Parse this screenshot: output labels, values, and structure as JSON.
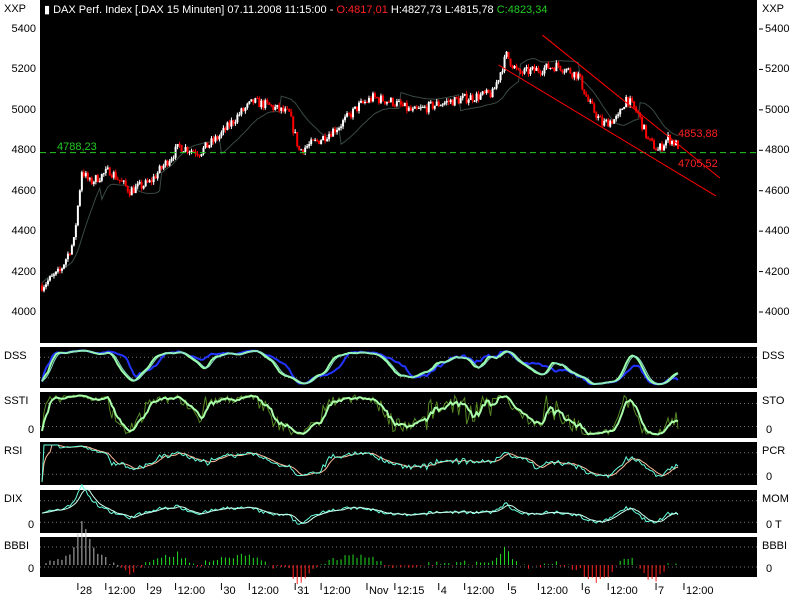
{
  "header": {
    "left_unit": "XXP",
    "right_unit": "XXP",
    "title": "DAX Perf. Index [.DAX  15 Minuten] 07.11.2008 11:15:00 - ",
    "open": "O:4817,01",
    "high_low": "H:4827,73 L:4815,78",
    "close": "C:4823,34"
  },
  "colors": {
    "up": "#ffffff",
    "down": "#ff0000",
    "ref_line": "#22cc22",
    "channel": "#ff0000",
    "band": "#3a4a44"
  },
  "chart_data": {
    "type": "candlestick",
    "title": "DAX Perf. Index [.DAX  15 Minuten]",
    "ylim": [
      3900,
      5500
    ],
    "yticks": [
      {
        "v": 4000,
        "label": "4000"
      },
      {
        "v": 4200,
        "label": "4200"
      },
      {
        "v": 4400,
        "label": "4400"
      },
      {
        "v": 4600,
        "label": "4600"
      },
      {
        "v": 4800,
        "label": "4800"
      },
      {
        "v": 5000,
        "label": "5000"
      },
      {
        "v": 5200,
        "label": "5200"
      },
      {
        "v": 5400,
        "label": "5400"
      }
    ],
    "bars": 320,
    "price_anchors": [
      [
        0,
        4130
      ],
      [
        9,
        4200
      ],
      [
        16,
        4350
      ],
      [
        20,
        4700
      ],
      [
        24,
        4640
      ],
      [
        34,
        4700
      ],
      [
        44,
        4600
      ],
      [
        54,
        4640
      ],
      [
        59,
        4700
      ],
      [
        69,
        4820
      ],
      [
        79,
        4790
      ],
      [
        89,
        4870
      ],
      [
        99,
        4980
      ],
      [
        106,
        5040
      ],
      [
        114,
        5020
      ],
      [
        124,
        4980
      ],
      [
        129,
        4800
      ],
      [
        139,
        4850
      ],
      [
        149,
        4920
      ],
      [
        159,
        5020
      ],
      [
        166,
        5060
      ],
      [
        176,
        5040
      ],
      [
        186,
        4990
      ],
      [
        199,
        5030
      ],
      [
        214,
        5060
      ],
      [
        226,
        5080
      ],
      [
        233,
        5270
      ],
      [
        239,
        5180
      ],
      [
        249,
        5200
      ],
      [
        259,
        5220
      ],
      [
        269,
        5170
      ],
      [
        274,
        5040
      ],
      [
        281,
        4930
      ],
      [
        289,
        4960
      ],
      [
        293,
        5060
      ],
      [
        299,
        4980
      ],
      [
        304,
        4850
      ],
      [
        309,
        4800
      ],
      [
        314,
        4860
      ],
      [
        319,
        4823
      ]
    ],
    "reference_line": {
      "value": 4788.23,
      "label": "4788,23"
    },
    "channel": {
      "upper": [
        [
          251,
          5370
        ],
        [
          340,
          4663
        ]
      ],
      "lower": [
        [
          229,
          5222
        ],
        [
          338,
          4574
        ]
      ],
      "labels": [
        {
          "v": 4853.88,
          "label": "4853,88"
        },
        {
          "v": 4705.52,
          "label": "4705,52"
        }
      ]
    },
    "xticks": [
      {
        "bar": 20,
        "label": "28"
      },
      {
        "bar": 34,
        "label": "12:00"
      },
      {
        "bar": 55,
        "label": "29"
      },
      {
        "bar": 69,
        "label": "12:00"
      },
      {
        "bar": 92,
        "label": "30"
      },
      {
        "bar": 106,
        "label": "12:00"
      },
      {
        "bar": 129,
        "label": "31"
      },
      {
        "bar": 142,
        "label": "12:00"
      },
      {
        "bar": 165,
        "label": "Nov"
      },
      {
        "bar": 179,
        "label": "12:15"
      },
      {
        "bar": 201,
        "label": "4"
      },
      {
        "bar": 214,
        "label": "12:00"
      },
      {
        "bar": 236,
        "label": "5"
      },
      {
        "bar": 251,
        "label": "12:00"
      },
      {
        "bar": 273,
        "label": "6"
      },
      {
        "bar": 286,
        "label": "12:00"
      },
      {
        "bar": 310,
        "label": "7"
      },
      {
        "bar": 324,
        "label": "12:00"
      }
    ],
    "panels": [
      {
        "id": "dss",
        "left": "DSS",
        "right": "DSS",
        "zero_left": "",
        "zero_right": ""
      },
      {
        "id": "ssti",
        "left": "SSTI",
        "right": "STO",
        "zero_left": "0",
        "zero_right": "0"
      },
      {
        "id": "rsi",
        "left": "RSI",
        "right": "PCR",
        "zero_left": "",
        "zero_right": "0"
      },
      {
        "id": "dix",
        "left": "DIX",
        "right": "MOM",
        "zero_left": "0",
        "zero_right": "0 T"
      },
      {
        "id": "bbbi",
        "left": "BBBI",
        "right": "BBBI",
        "zero_left": "0",
        "zero_right": "0"
      }
    ]
  }
}
